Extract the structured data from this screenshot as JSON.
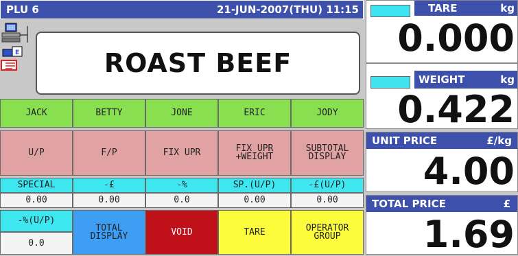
{
  "header": {
    "plu": "PLU 6",
    "datetime": "21-JUN-2007(THU) 11:15"
  },
  "product_name": "ROAST BEEF",
  "operators": [
    "JACK",
    "BETTY",
    "JONE",
    "ERIC",
    "JODY"
  ],
  "function_keys": {
    "up": "U/P",
    "fp": "F/P",
    "fix_upr": "FIX UPR",
    "fix_upr_weight_1": "FIX UPR",
    "fix_upr_weight_2": "+WEIGHT",
    "subtotal_1": "SUBTOTAL",
    "subtotal_2": "DISPLAY"
  },
  "discounts": {
    "labels": [
      "SPECIAL",
      "-£",
      "-%",
      "SP.(U/P)",
      "-£(U/P)"
    ],
    "values": [
      "0.00",
      "0.00",
      "0.0",
      "0.00",
      "0.00"
    ],
    "pct_up_label": "-%(U/P)",
    "pct_up_value": "0.0"
  },
  "bottom_keys": {
    "total_1": "TOTAL",
    "total_2": "DISPLAY",
    "void": "VOID",
    "tare": "TARE",
    "operator_1": "OPERATOR",
    "operator_2": "GROUP"
  },
  "panels": {
    "tare": {
      "title": "TARE",
      "unit": "kg",
      "value": "0.000"
    },
    "weight": {
      "title": "WEIGHT",
      "unit": "kg",
      "value": "0.422"
    },
    "unit_price": {
      "title": "UNIT PRICE",
      "unit": "£/kg",
      "value": "4.00"
    },
    "total_price": {
      "title": "TOTAL PRICE",
      "unit": "£",
      "value": "1.69"
    }
  },
  "colors": {
    "header_blue": "#3c50ac",
    "operator_green": "#88e050",
    "key_pink": "#e0a2a2",
    "discount_cyan": "#3ee6f0",
    "total_blue": "#3e9ef4",
    "void_red": "#c0101a",
    "key_yellow": "#fcfc3c"
  }
}
